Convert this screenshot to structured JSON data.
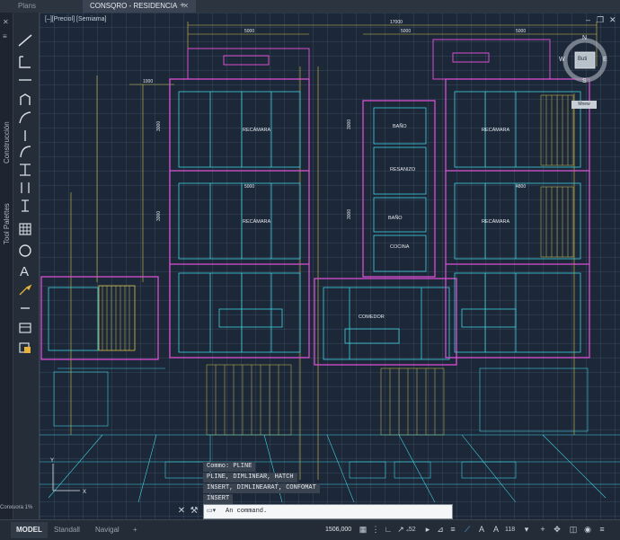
{
  "doc_tabs": [
    {
      "label": "Plans",
      "active": false
    },
    {
      "label": "CONSQRO - RESIDENCIA",
      "active": true
    }
  ],
  "viewport": {
    "label": "[–][Preciol] [Semiama]",
    "corner_label": "tuoi",
    "dims_top": [
      "17000",
      "5000",
      "5000",
      "5000"
    ],
    "dims_floor": [
      "1000",
      "5000",
      "4800"
    ],
    "dims_vertical": [
      "3000",
      "3000",
      "3000",
      "3000"
    ],
    "rooms": [
      "RECÁMARA",
      "RECÁMARA",
      "RECÁMARA",
      "RECÁMARA",
      "BAÑO",
      "RESANIZO",
      "BAÑO",
      "COCINA",
      "COMEDOR"
    ]
  },
  "palette": {
    "title1": "Construcción",
    "title2": "Tool Palettes",
    "bottom": "Conxuora 1%"
  },
  "viewcube": {
    "n": "N",
    "s": "S",
    "e": "E",
    "w": "W",
    "face": "Buti",
    "menu": "Mnew"
  },
  "command_history": [
    "Commo: PLINE",
    "PLINE, DIMLINEAR, HATCH",
    "INSERT, DIMLINEARAT, CONFOMAT",
    "INSERT"
  ],
  "command_line": {
    "text": "An command."
  },
  "status": {
    "tabs": [
      {
        "label": "MODEL",
        "active": true
      },
      {
        "label": "Standall",
        "active": false
      },
      {
        "label": "Navigal",
        "active": false
      }
    ],
    "add": "+",
    "coords": "1506,000",
    "angle": "₄52",
    "scale": "118"
  },
  "colors": {
    "magenta": "#d84fd1",
    "cyan": "#3fd2e0",
    "yellow": "#d6c34a",
    "background": "#1c2738"
  }
}
